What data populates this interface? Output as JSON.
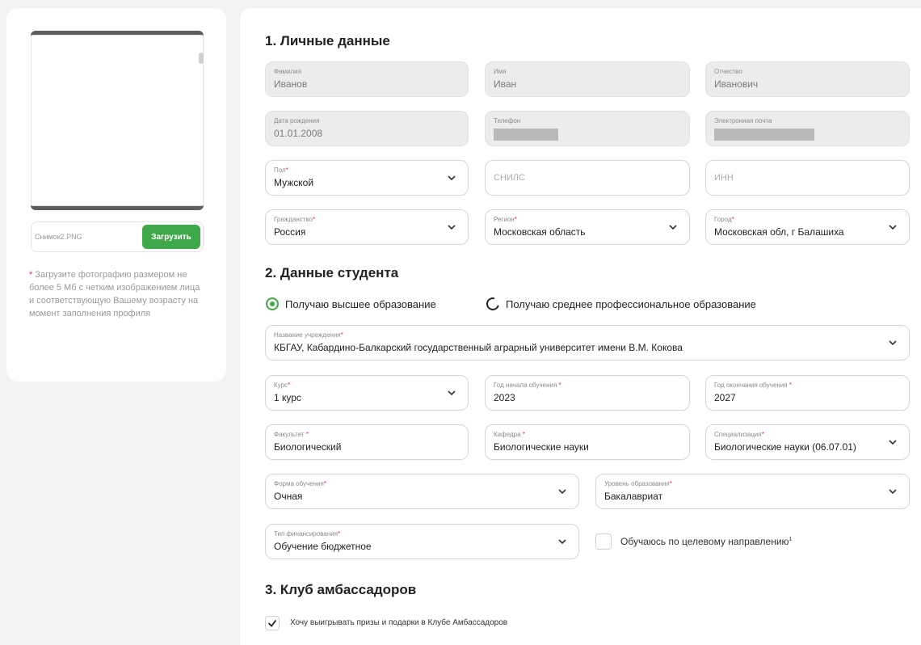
{
  "photo": {
    "file_name": "Снимок2.PNG",
    "upload_label": "Загрузить",
    "hint": "Загрузите фотографию размером не более 5 Мб с четким изображением лица и соответствующую Вашему возрасту на момент заполнения профиля"
  },
  "section1": {
    "title": "1. Личные данные",
    "last_name": {
      "label": "Фамилия",
      "value": "Иванов"
    },
    "first_name": {
      "label": "Имя",
      "value": "Иван"
    },
    "patronymic": {
      "label": "Отчество",
      "value": "Иванович"
    },
    "birth_date": {
      "label": "Дата рождения",
      "value": "01.01.2008"
    },
    "phone": {
      "label": "Телефон"
    },
    "email": {
      "label": "Электронная почта"
    },
    "gender": {
      "label": "Пол",
      "value": "Мужской"
    },
    "snils": {
      "placeholder": "СНИЛС"
    },
    "inn": {
      "placeholder": "ИНН"
    },
    "citizenship": {
      "label": "Гражданство",
      "value": "Россия"
    },
    "region": {
      "label": "Регион",
      "value": "Московская область"
    },
    "city": {
      "label": "Город",
      "value": "Московская обл, г Балашиха"
    }
  },
  "section2": {
    "title": "2. Данные студента",
    "radio_higher": "Получаю высшее образование",
    "radio_vocational": "Получаю среднее профессиональное образование",
    "institution": {
      "label": "Название учреждения",
      "value": "КБГАУ, Кабардино-Балкарский государственный аграрный университет имени В.М. Кокова"
    },
    "course": {
      "label": "Курс",
      "value": "1 курс"
    },
    "start_year": {
      "label": "Год начала обучения",
      "value": "2023"
    },
    "end_year": {
      "label": "Год окончания обучения",
      "value": "2027"
    },
    "faculty": {
      "label": "Факультет",
      "value": "Биологический"
    },
    "department": {
      "label": "Кафедра",
      "value": "Биологические науки"
    },
    "specialization": {
      "label": "Специализация",
      "value": "Биологические науки (06.07.01)"
    },
    "study_form": {
      "label": "Форма обучения",
      "value": "Очная"
    },
    "edu_level": {
      "label": "Уровень образования",
      "value": "Бакалавриат"
    },
    "funding": {
      "label": "Тип финансирования",
      "value": "Обучение бюджетное"
    },
    "target_direction": "Обучаюсь по целевому направлению",
    "target_sup": "1"
  },
  "section3": {
    "title": "3. Клуб амбассадоров",
    "prizes_label": "Хочу выигрывать призы и подарки в Клубе Амбассадоров"
  },
  "colors": {
    "accent": "#3fa84b",
    "required": "#e0313a"
  }
}
